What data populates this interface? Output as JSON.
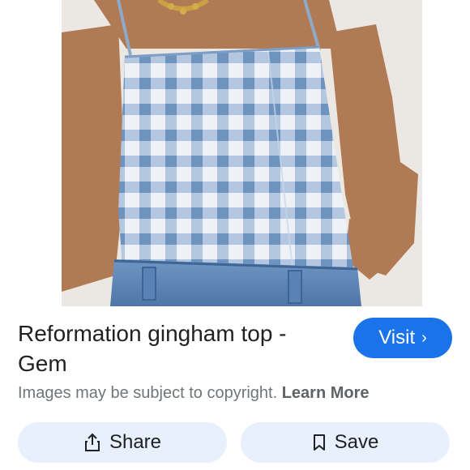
{
  "result": {
    "title": "Reformation gingham top - Gem",
    "visit_label": "Visit",
    "copyright_text": "Images may be subject to copyright.",
    "learn_more_label": "Learn More"
  },
  "actions": {
    "share_label": "Share",
    "save_label": "Save"
  },
  "icons": {
    "visit": "chevron-right-icon",
    "share": "share-icon",
    "save": "bookmark-icon"
  },
  "colors": {
    "accent": "#1a73e8",
    "action_button_bg": "#e8f0fe",
    "secondary_text": "#70757a"
  }
}
